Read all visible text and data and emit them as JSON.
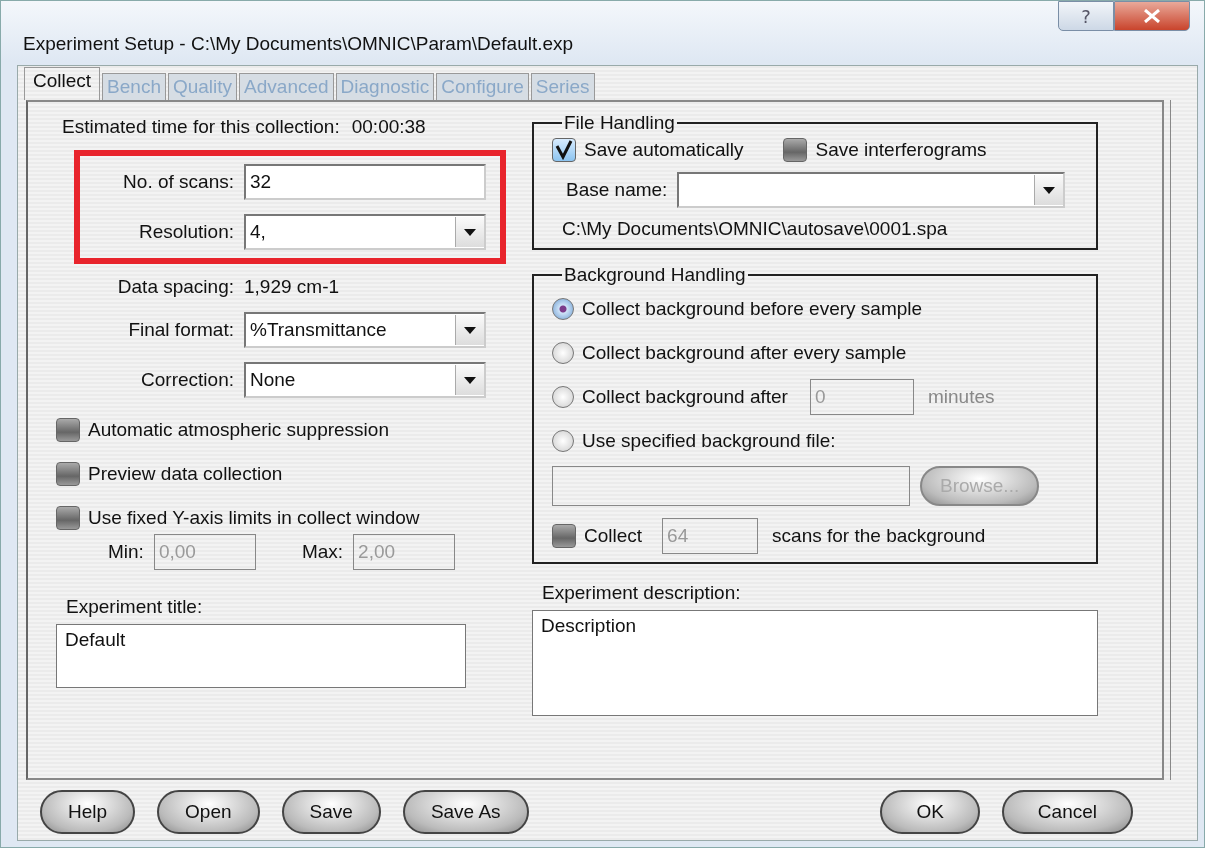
{
  "window": {
    "title": "Experiment Setup - C:\\My Documents\\OMNIC\\Param\\Default.exp",
    "help_button": "?"
  },
  "tabs": [
    {
      "label": "Collect",
      "selected": true
    },
    {
      "label": "Bench",
      "selected": false
    },
    {
      "label": "Quality",
      "selected": false
    },
    {
      "label": "Advanced",
      "selected": false
    },
    {
      "label": "Diagnostic",
      "selected": false
    },
    {
      "label": "Configure",
      "selected": false
    },
    {
      "label": "Series",
      "selected": false
    }
  ],
  "estimated": {
    "label": "Estimated time for this collection:",
    "value": "00:00:38"
  },
  "highlighted": true,
  "scans": {
    "label": "No. of scans:",
    "value": "32"
  },
  "resolution": {
    "label": "Resolution:",
    "value": "4,"
  },
  "data_spacing": {
    "label": "Data spacing:",
    "value": "1,929 cm-1"
  },
  "dropdowns": [
    {
      "label": "Final format:",
      "value": "%Transmittance"
    },
    {
      "label": "Correction:",
      "value": "None"
    }
  ],
  "options": [
    {
      "label": "Automatic atmospheric suppression",
      "checked": false
    },
    {
      "label": "Preview data collection",
      "checked": false
    },
    {
      "label": "Use fixed Y-axis limits in collect window",
      "checked": false
    }
  ],
  "limits": [
    {
      "label": "Min:",
      "value": "0,00",
      "disabled": true
    },
    {
      "label": "Max:",
      "value": "2,00",
      "disabled": true
    }
  ],
  "experiment_title": {
    "label": "Experiment title:",
    "value": "Default"
  },
  "file_handling": {
    "legend": "File Handling",
    "checks": [
      {
        "label": "Save automatically",
        "checked": true
      },
      {
        "label": "Save interferograms",
        "checked": false
      }
    ],
    "base_name_label": "Base name:",
    "path": "C:\\My Documents\\OMNIC\\autosave\\0001.spa"
  },
  "background": {
    "legend": "Background Handling",
    "radios": [
      {
        "label": "Collect background before every sample",
        "selected": true
      },
      {
        "label": "Collect background after every sample",
        "selected": false
      },
      {
        "label": "Collect background after",
        "selected": false,
        "field": "0",
        "unit": "minutes"
      },
      {
        "label": "Use specified background file:",
        "selected": false
      }
    ],
    "browse": {
      "label": "Browse...",
      "disabled": true
    },
    "collect": {
      "label": "Collect",
      "checked": false,
      "value": "64",
      "suffix": "scans for the background",
      "disabled": true
    }
  },
  "experiment_description": {
    "label": "Experiment description:",
    "value": "Description"
  },
  "buttons_left": [
    "Help",
    "Open",
    "Save",
    "Save As"
  ],
  "buttons_right": [
    "OK",
    "Cancel"
  ]
}
